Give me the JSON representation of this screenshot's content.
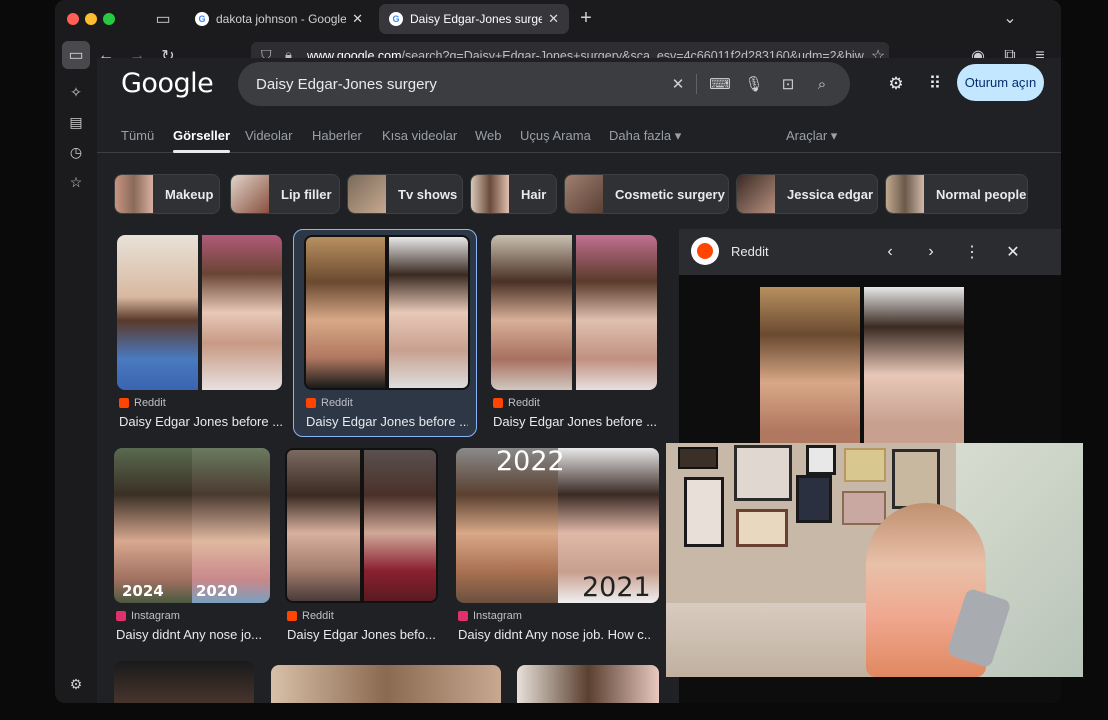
{
  "browser": {
    "tabs": [
      {
        "title": "dakota johnson - Google'da Ara",
        "active": false
      },
      {
        "title": "Daisy Edgar-Jones surgery - Go",
        "active": true
      }
    ],
    "new_tab": "+",
    "url_host": "www.google.com",
    "url_rest": "/search?q=Daisy+Edgar-Jones+surgery&sca_esv=4c66011f2d283160&udm=2&biw"
  },
  "google": {
    "logo": "Google",
    "query": "Daisy Edgar-Jones surgery",
    "signin": "Oturum açın",
    "nav_tabs": [
      "Tümü",
      "Görseller",
      "Videolar",
      "Haberler",
      "Kısa videolar",
      "Web",
      "Uçuş Arama",
      "Daha fazla ▾"
    ],
    "tools": "Araçlar ▾",
    "chips": [
      "Makeup",
      "Lip filler",
      "Tv shows",
      "Hair",
      "Cosmetic surgery",
      "Jessica edgar",
      "Normal people"
    ]
  },
  "results": [
    {
      "source": "Reddit",
      "caption": "Daisy Edgar Jones before ..."
    },
    {
      "source": "Reddit",
      "caption": "Daisy Edgar Jones before ..."
    },
    {
      "source": "Reddit",
      "caption": "Daisy Edgar Jones before ..."
    },
    {
      "source": "Instagram",
      "caption": "Daisy didnt Any nose jo...",
      "years": [
        "2024",
        "2020"
      ]
    },
    {
      "source": "Reddit",
      "caption": "Daisy Edgar Jones befo..."
    },
    {
      "source": "Instagram",
      "caption": "Daisy didnt Any nose job. How c...",
      "years": [
        "2022",
        "2021"
      ]
    }
  ],
  "preview": {
    "source": "Reddit"
  },
  "colors": {
    "accent": "#8ab4f8",
    "reddit": "#ff4500",
    "instagram": "#e1306c",
    "signin_bg": "#c2e7ff"
  }
}
